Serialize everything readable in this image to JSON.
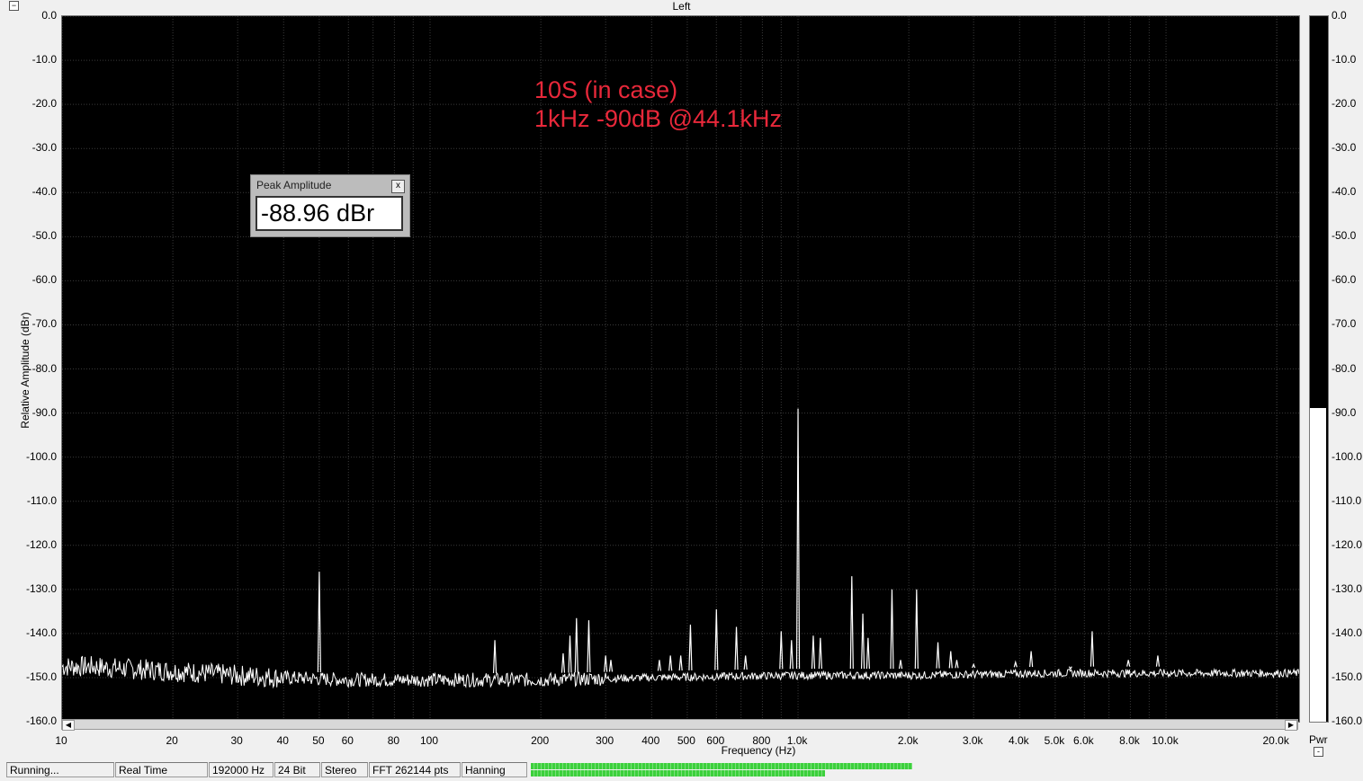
{
  "window": {
    "title": "Left",
    "collapse_icon": "minus-box-icon"
  },
  "annotation": {
    "line1": "10S (in case)",
    "line2": "1kHz -90dB @44.1kHz",
    "color": "#e8283a"
  },
  "peak_window": {
    "title": "Peak Amplitude",
    "value": "-88.96 dBr",
    "close_label": "x"
  },
  "meter": {
    "label": "Pwr",
    "level_dBr": -88.96,
    "collapse_label": "-"
  },
  "status_bar": {
    "state": "Running...",
    "mode": "Real Time",
    "sample_rate": "192000 Hz",
    "bit_depth": "24 Bit",
    "channels": "Stereo",
    "fft": "FFT 262144 pts",
    "window": "Hanning",
    "progress_top_fraction": 0.996,
    "progress_bottom_fraction": 0.767
  },
  "chart_data": {
    "type": "line",
    "xlabel": "Frequency (Hz)",
    "ylabel": "Relative Amplitude (dBr)",
    "x_scale": "log",
    "xlim": [
      10,
      23000
    ],
    "ylim": [
      -160,
      0
    ],
    "x_ticks": [
      {
        "v": 10,
        "label": "10"
      },
      {
        "v": 20,
        "label": "20"
      },
      {
        "v": 30,
        "label": "30"
      },
      {
        "v": 40,
        "label": "40"
      },
      {
        "v": 50,
        "label": "50"
      },
      {
        "v": 60,
        "label": "60"
      },
      {
        "v": 80,
        "label": "80"
      },
      {
        "v": 100,
        "label": "100"
      },
      {
        "v": 200,
        "label": "200"
      },
      {
        "v": 300,
        "label": "300"
      },
      {
        "v": 400,
        "label": "400"
      },
      {
        "v": 500,
        "label": "500"
      },
      {
        "v": 600,
        "label": "600"
      },
      {
        "v": 800,
        "label": "800"
      },
      {
        "v": 1000,
        "label": "1.0k"
      },
      {
        "v": 2000,
        "label": "2.0k"
      },
      {
        "v": 3000,
        "label": "3.0k"
      },
      {
        "v": 4000,
        "label": "4.0k"
      },
      {
        "v": 5000,
        "label": "5.0k"
      },
      {
        "v": 6000,
        "label": "6.0k"
      },
      {
        "v": 8000,
        "label": "8.0k"
      },
      {
        "v": 10000,
        "label": "10.0k"
      },
      {
        "v": 20000,
        "label": "20.0k"
      }
    ],
    "y_ticks": [
      "0.0",
      "-10.0",
      "-20.0",
      "-30.0",
      "-40.0",
      "-50.0",
      "-60.0",
      "-70.0",
      "-80.0",
      "-90.0",
      "-100.0",
      "-110.0",
      "-120.0",
      "-130.0",
      "-140.0",
      "-150.0",
      "-160.0"
    ],
    "grid": true,
    "line_color": "#ffffff",
    "noise_floor": [
      [
        10,
        -147.5
      ],
      [
        12,
        -147.5
      ],
      [
        15,
        -148
      ],
      [
        20,
        -148.5
      ],
      [
        30,
        -149.5
      ],
      [
        40,
        -150
      ],
      [
        60,
        -150.5
      ],
      [
        100,
        -150.5
      ],
      [
        200,
        -150.5
      ],
      [
        400,
        -150
      ],
      [
        1000,
        -149.5
      ],
      [
        2000,
        -149.5
      ],
      [
        5000,
        -149
      ],
      [
        10000,
        -149
      ],
      [
        23000,
        -149
      ]
    ],
    "peaks": [
      [
        50,
        -126
      ],
      [
        150,
        -141.5
      ],
      [
        230,
        -144.5
      ],
      [
        240,
        -140.5
      ],
      [
        250,
        -136.5
      ],
      [
        270,
        -137
      ],
      [
        300,
        -145
      ],
      [
        310,
        -146
      ],
      [
        420,
        -146
      ],
      [
        450,
        -145
      ],
      [
        480,
        -145
      ],
      [
        510,
        -138
      ],
      [
        600,
        -134.5
      ],
      [
        680,
        -138.5
      ],
      [
        720,
        -145
      ],
      [
        900,
        -139.5
      ],
      [
        960,
        -141.5
      ],
      [
        1000,
        -89
      ],
      [
        1100,
        -140.5
      ],
      [
        1150,
        -141
      ],
      [
        1400,
        -127
      ],
      [
        1500,
        -135.5
      ],
      [
        1550,
        -141
      ],
      [
        1800,
        -130
      ],
      [
        1900,
        -146
      ],
      [
        2100,
        -130
      ],
      [
        2400,
        -142
      ],
      [
        2600,
        -144
      ],
      [
        2700,
        -146
      ],
      [
        3000,
        -147
      ],
      [
        3900,
        -146.5
      ],
      [
        4300,
        -144
      ],
      [
        5500,
        -148
      ],
      [
        6300,
        -139.5
      ],
      [
        7900,
        -146
      ],
      [
        9500,
        -145
      ]
    ]
  }
}
